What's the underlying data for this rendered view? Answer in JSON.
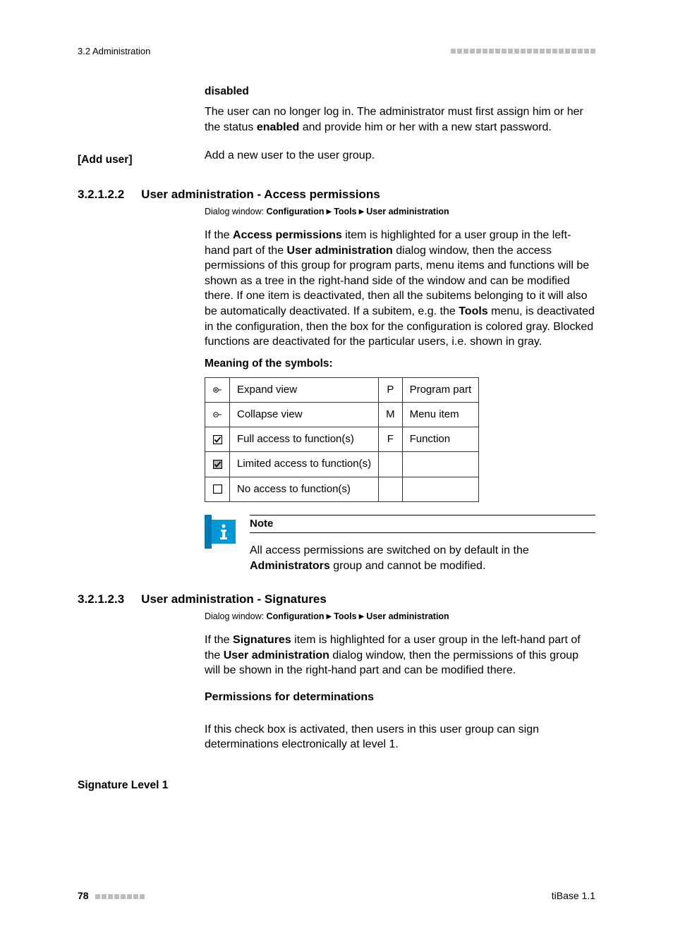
{
  "runhead": {
    "left": "3.2 Administration"
  },
  "disabled": {
    "heading": "disabled",
    "text_a": "The user can no longer log in. The administrator must first assign him or her the status ",
    "text_bold": "enabled",
    "text_b": " and provide him or her with a new start password."
  },
  "add_user": {
    "label": "[Add user]",
    "text": "Add a new user to the user group."
  },
  "sec322": {
    "num": "3.2.1.2.2",
    "title": "User administration - Access permissions",
    "dlg_prefix": "Dialog window: ",
    "dlg_a": "Configuration",
    "dlg_b": "Tools",
    "dlg_c": "User administration",
    "p1_a": "If the ",
    "p1_bold1": "Access permissions",
    "p1_b": " item is highlighted for a user group in the left-hand part of the ",
    "p1_bold2": "User administration",
    "p1_c": " dialog window, then the access permissions of this group for program parts, menu items and functions will be shown as a tree in the right-hand side of the window and can be modified there. If one item is deactivated, then all the subitems belonging to it will also be automatically deactivated. If a subitem, e.g. the ",
    "p1_bold3": "Tools",
    "p1_d": " menu, is deactivated in the configuration, then the box for the configuration is colored gray. Blocked functions are deactivated for the particular users, i.e. shown in gray.",
    "meaning": "Meaning of the symbols:",
    "rows": [
      {
        "desc": "Expand view",
        "code": "P",
        "right": "Program part"
      },
      {
        "desc": "Collapse view",
        "code": "M",
        "right": "Menu item"
      },
      {
        "desc": "Full access to function(s)",
        "code": "F",
        "right": "Function"
      },
      {
        "desc": "Limited access to function(s)",
        "code": "",
        "right": ""
      },
      {
        "desc": "No access to function(s)",
        "code": "",
        "right": ""
      }
    ],
    "note_label": "Note",
    "note_a": "All access permissions are switched on by default in the ",
    "note_bold": "Administrators",
    "note_b": " group and cannot be modified."
  },
  "sec323": {
    "num": "3.2.1.2.3",
    "title": "User administration - Signatures",
    "dlg_prefix": "Dialog window: ",
    "dlg_a": "Configuration",
    "dlg_b": "Tools",
    "dlg_c": "User administration",
    "p1_a": "If the ",
    "p1_bold1": "Signatures",
    "p1_b": " item is highlighted for a user group in the left-hand part of the ",
    "p1_bold2": "User administration",
    "p1_c": " dialog window, then the permissions of this group will be shown in the right-hand part and can be modified there.",
    "perm_heading": "Permissions for determinations",
    "sig_label": "Signature Level 1",
    "sig_text": "If this check box is activated, then users in this user group can sign determinations electronically at level 1."
  },
  "footer": {
    "page": "78",
    "right": "tiBase 1.1"
  }
}
